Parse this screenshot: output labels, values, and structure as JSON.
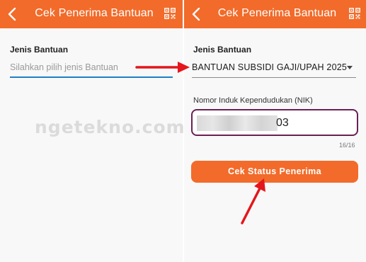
{
  "watermark": "ngetekno.com",
  "colors": {
    "accent": "#f26b2a",
    "field_border": "#6b1f55",
    "annotation": "#e4161b",
    "underline": "#1f7fc4"
  },
  "left_screen": {
    "appbar": {
      "title": "Cek Penerima Bantuan",
      "back_icon": "chevron-left-icon",
      "qr_icon": "qr-code-icon"
    },
    "jenis_label": "Jenis Bantuan",
    "jenis_placeholder": "Silahkan pilih jenis Bantuan"
  },
  "right_screen": {
    "appbar": {
      "title": "Cek Penerima Bantuan",
      "back_icon": "chevron-left-icon",
      "qr_icon": "qr-code-icon"
    },
    "jenis_label": "Jenis Bantuan",
    "jenis_value": "BANTUAN SUBSIDI GAJI/UPAH 2025",
    "dropdown_icon": "caret-down-icon",
    "nik_label": "Nomor Induk Kependudukan (NIK)",
    "nik_visible_suffix": "03",
    "nik_counter": "16/16",
    "submit_button": "Cek Status Penerima"
  }
}
